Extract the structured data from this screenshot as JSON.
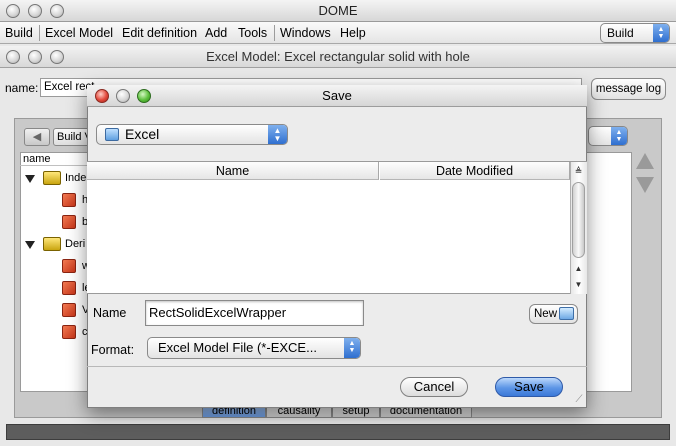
{
  "app": {
    "title": "DOME"
  },
  "menubar": {
    "items": [
      "Build",
      "Excel Model",
      "Edit definition",
      "Add",
      "Tools",
      "Windows",
      "Help"
    ],
    "mode_select": "Build"
  },
  "model_window": {
    "title": "Excel Model: Excel rectangular solid with hole",
    "name_label": "name:",
    "name_value": "Excel rect",
    "message_log_label": "message log",
    "build_view_label": "Build V",
    "tree_header": "name",
    "tree_items": [
      {
        "label": "Inde",
        "kind": "folder"
      },
      {
        "label": "h",
        "kind": "param"
      },
      {
        "label": "b",
        "kind": "param"
      },
      {
        "label": "Deri",
        "kind": "folder"
      },
      {
        "label": "w",
        "kind": "param"
      },
      {
        "label": "le",
        "kind": "param"
      },
      {
        "label": "V",
        "kind": "param"
      },
      {
        "label": "c",
        "kind": "param"
      }
    ],
    "bottom_tabs": [
      "definition",
      "causality",
      "setup",
      "documentation"
    ]
  },
  "save_dialog": {
    "title": "Save",
    "location": "Excel",
    "columns": {
      "name": "Name",
      "date_modified": "Date Modified"
    },
    "name_label": "Name",
    "name_value": "RectSolidExcelWrapper",
    "new_folder_label": "New",
    "format_label": "Format:",
    "format_value": "Excel Model File (*-EXCE...",
    "cancel_label": "Cancel",
    "save_label": "Save"
  },
  "icons": {
    "close": "close-icon",
    "minimize": "minimize-icon",
    "zoom": "zoom-icon",
    "folder": "folder-icon",
    "parameter": "parameter-cube-icon"
  },
  "colors": {
    "accent": "#3b78d8",
    "status_bar": "#5d5d5d",
    "param_icon": "#d9482a"
  }
}
